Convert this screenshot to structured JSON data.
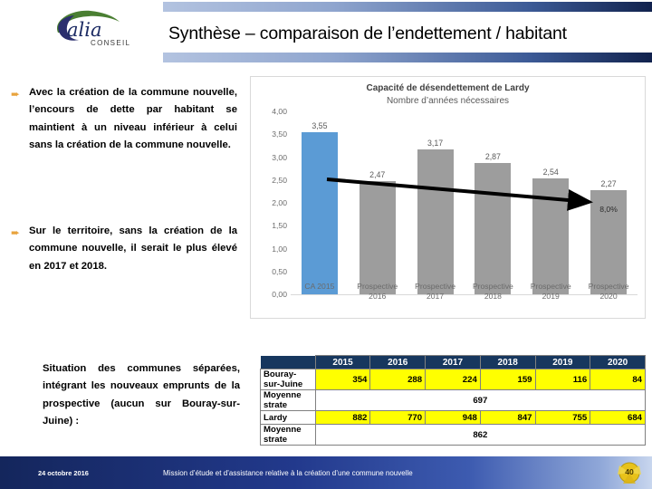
{
  "header": {
    "title": "Synthèse – comparaison de l’endettement / habitant",
    "logo_text": "Calia",
    "logo_subtext": "CONSEIL"
  },
  "bullets": [
    {
      "marker": "➨",
      "text": "Avec la création de la commune nouvelle, l’encours de dette par habitant se maintient à un niveau inférieur à celui sans la création de la commune nouvelle."
    },
    {
      "marker": "➨",
      "text": "Sur le territoire, sans la création de la commune nouvelle, il serait le plus élevé en 2017 et 2018."
    }
  ],
  "situation_text": "Situation des communes séparées, intégrant les nouveaux emprunts de la prospective (aucun sur Bouray-sur-Juine) :",
  "chart_data": {
    "type": "bar",
    "title": "Capacité de désendettement de Lardy",
    "subtitle": "Nombre d’années nécessaires",
    "xlabel": "",
    "ylabel": "",
    "ylim": [
      0.0,
      4.0
    ],
    "ytick_labels": [
      "4,00",
      "3,50",
      "3,00",
      "2,50",
      "2,00",
      "1,50",
      "1,00",
      "0,50",
      "0,00"
    ],
    "ytick_values": [
      4.0,
      3.5,
      3.0,
      2.5,
      2.0,
      1.5,
      1.0,
      0.5,
      0.0
    ],
    "grid": false,
    "legend": "none",
    "categories": [
      "CA 2015",
      "Prospective 2016",
      "Prospective 2017",
      "Prospective 2018",
      "Prospective 2019",
      "Prospective 2020"
    ],
    "values": [
      3.55,
      2.47,
      3.17,
      2.87,
      2.54,
      2.27
    ],
    "value_labels": [
      "3,55",
      "2,47",
      "3,17",
      "2,87",
      "2,54",
      "2,27"
    ],
    "bar_colors": [
      "#5B9BD5",
      "#9d9d9d",
      "#9d9d9d",
      "#9d9d9d",
      "#9d9d9d",
      "#9d9d9d"
    ],
    "accent_color": "#5B9BD5",
    "annotations": [
      {
        "text": "8,0%",
        "category": "Prospective 2020"
      }
    ],
    "trend_arrow": {
      "from_category": "Prospective 2016",
      "to_category": "Prospective 2020",
      "direction": "down"
    }
  },
  "table": {
    "columns": [
      "2015",
      "2016",
      "2017",
      "2018",
      "2019",
      "2020"
    ],
    "rows": [
      {
        "label": "Bouray-sur-Juine",
        "style": "yellow",
        "values": [
          "354",
          "288",
          "224",
          "159",
          "116",
          "84"
        ]
      },
      {
        "label": "Moyenne strate",
        "style": "merged",
        "merged_value": "697"
      },
      {
        "label": "Lardy",
        "style": "yellow",
        "values": [
          "882",
          "770",
          "948",
          "847",
          "755",
          "684"
        ]
      },
      {
        "label": "Moyenne strate",
        "style": "merged",
        "merged_value": "862"
      }
    ]
  },
  "footer": {
    "date": "24 octobre 2016",
    "mission": "Mission d’étude et d’assistance relative à la création d’une commune nouvelle",
    "page_number": "40"
  }
}
